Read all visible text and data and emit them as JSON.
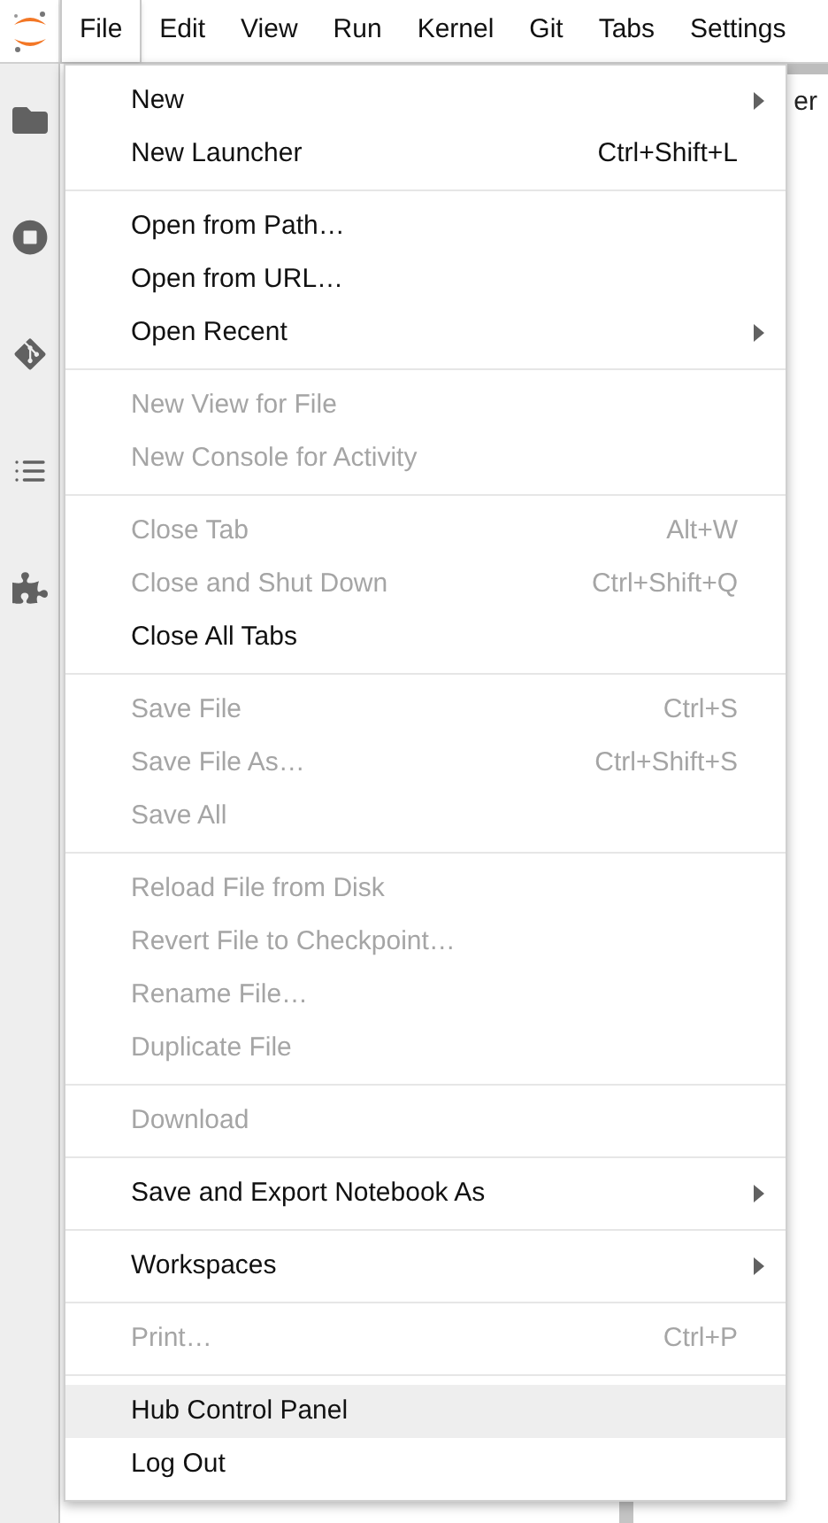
{
  "menubar": [
    {
      "label": "File",
      "selected": true
    },
    {
      "label": "Edit",
      "selected": false
    },
    {
      "label": "View",
      "selected": false
    },
    {
      "label": "Run",
      "selected": false
    },
    {
      "label": "Kernel",
      "selected": false
    },
    {
      "label": "Git",
      "selected": false
    },
    {
      "label": "Tabs",
      "selected": false
    },
    {
      "label": "Settings",
      "selected": false
    }
  ],
  "background_tab": {
    "label": "er"
  },
  "file_menu": {
    "sections": [
      {
        "items": [
          {
            "label": "New",
            "disabled": false,
            "submenu": true,
            "highlighted": false
          },
          {
            "label": "New Launcher",
            "shortcut": "Ctrl+Shift+L",
            "disabled": false,
            "submenu": false,
            "highlighted": false
          }
        ]
      },
      {
        "items": [
          {
            "label": "Open from Path…",
            "disabled": false,
            "submenu": false,
            "highlighted": false
          },
          {
            "label": "Open from URL…",
            "disabled": false,
            "submenu": false,
            "highlighted": false
          },
          {
            "label": "Open Recent",
            "disabled": false,
            "submenu": true,
            "highlighted": false
          }
        ]
      },
      {
        "items": [
          {
            "label": "New View for File",
            "disabled": true,
            "submenu": false,
            "highlighted": false
          },
          {
            "label": "New Console for Activity",
            "disabled": true,
            "submenu": false,
            "highlighted": false
          }
        ]
      },
      {
        "items": [
          {
            "label": "Close Tab",
            "shortcut": "Alt+W",
            "disabled": true,
            "submenu": false,
            "highlighted": false
          },
          {
            "label": "Close and Shut Down",
            "shortcut": "Ctrl+Shift+Q",
            "disabled": true,
            "submenu": false,
            "highlighted": false
          },
          {
            "label": "Close All Tabs",
            "disabled": false,
            "submenu": false,
            "highlighted": false
          }
        ]
      },
      {
        "items": [
          {
            "label": "Save File",
            "shortcut": "Ctrl+S",
            "disabled": true,
            "submenu": false,
            "highlighted": false
          },
          {
            "label": "Save File As…",
            "shortcut": "Ctrl+Shift+S",
            "disabled": true,
            "submenu": false,
            "highlighted": false
          },
          {
            "label": "Save All",
            "disabled": true,
            "submenu": false,
            "highlighted": false
          }
        ]
      },
      {
        "items": [
          {
            "label": "Reload File from Disk",
            "disabled": true,
            "submenu": false,
            "highlighted": false
          },
          {
            "label": "Revert File to Checkpoint…",
            "disabled": true,
            "submenu": false,
            "highlighted": false
          },
          {
            "label": "Rename File…",
            "disabled": true,
            "submenu": false,
            "highlighted": false
          },
          {
            "label": "Duplicate File",
            "disabled": true,
            "submenu": false,
            "highlighted": false
          }
        ]
      },
      {
        "items": [
          {
            "label": "Download",
            "disabled": true,
            "submenu": false,
            "highlighted": false
          }
        ]
      },
      {
        "items": [
          {
            "label": "Save and Export Notebook As",
            "disabled": false,
            "submenu": true,
            "highlighted": false
          }
        ]
      },
      {
        "items": [
          {
            "label": "Workspaces",
            "disabled": false,
            "submenu": true,
            "highlighted": false
          }
        ]
      },
      {
        "items": [
          {
            "label": "Print…",
            "shortcut": "Ctrl+P",
            "disabled": true,
            "submenu": false,
            "highlighted": false
          }
        ]
      },
      {
        "items": [
          {
            "label": "Hub Control Panel",
            "disabled": false,
            "submenu": false,
            "highlighted": true
          },
          {
            "label": "Log Out",
            "disabled": false,
            "submenu": false,
            "highlighted": false
          }
        ]
      }
    ]
  }
}
